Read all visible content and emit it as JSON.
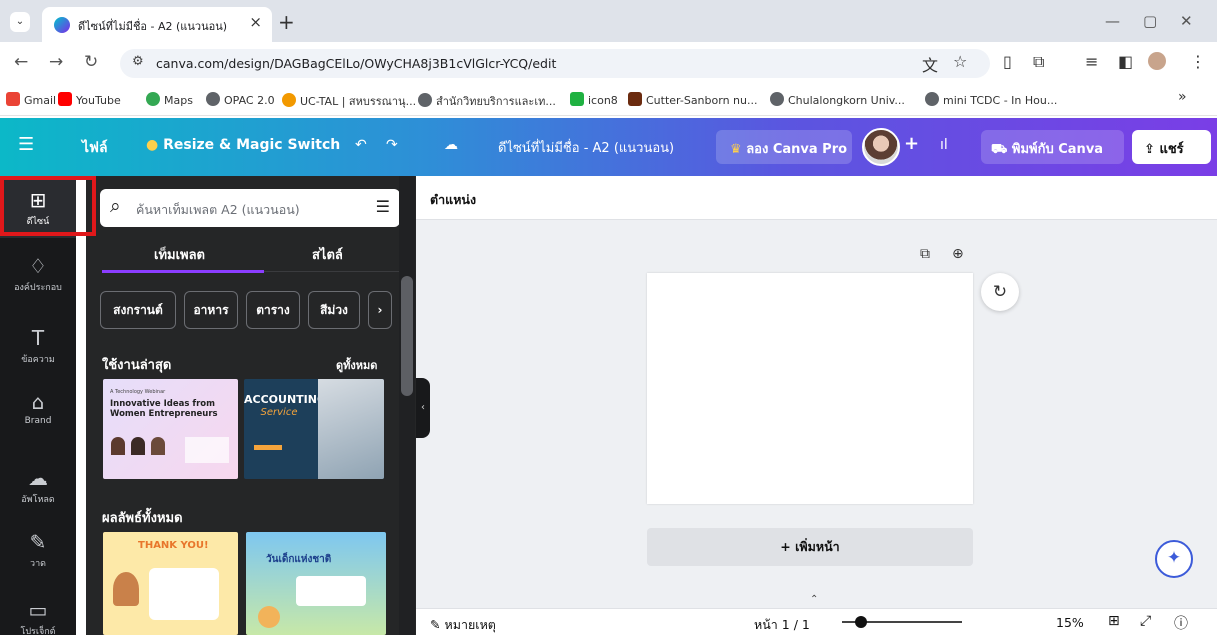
{
  "browser": {
    "tab_title": "ดีไซน์ที่ไม่มีชื่อ - A2 (แนวนอน)",
    "tab_close": "×",
    "new_tab": "+",
    "url": "canva.com/design/DAGBagCElLo/OWyCHA8j3B1cVlGlcr-YCQ/edit",
    "bookmarks": [
      {
        "label": "Gmail",
        "color": "#ea4335"
      },
      {
        "label": "YouTube",
        "color": "#ff0000"
      },
      {
        "label": "Maps",
        "color": "#34a853"
      },
      {
        "label": "OPAC 2.0",
        "color": "#5f6368"
      },
      {
        "label": "UC-TAL | สหบรรณานุ...",
        "color": "#f29900"
      },
      {
        "label": "สำนักวิทยบริการและเท...",
        "color": "#5f6368"
      },
      {
        "label": "icon8",
        "color": "#1fb141"
      },
      {
        "label": "Cutter-Sanborn nu...",
        "color": "#6b2b0f"
      },
      {
        "label": "Chulalongkorn Univ...",
        "color": "#5f6368"
      },
      {
        "label": "mini TCDC - In Hou...",
        "color": "#5f6368"
      }
    ],
    "more": "»"
  },
  "header": {
    "menu_icon": "☰",
    "file": "ไฟล์",
    "resize": "Resize & Magic Switch",
    "doc_title": "ดีไซน์ที่ไม่มีชื่อ - A2 (แนวนอน)",
    "try_pro": "ลอง Canva Pro",
    "print": "พิมพ์กับ Canva",
    "share": "แชร์"
  },
  "rail": [
    {
      "icon": "⊞",
      "label": "ดีไซน์"
    },
    {
      "icon": "♢",
      "label": "องค์ประกอบ"
    },
    {
      "icon": "T",
      "label": "ข้อความ"
    },
    {
      "icon": "⌂",
      "label": "Brand"
    },
    {
      "icon": "☁",
      "label": "อัพโหลด"
    },
    {
      "icon": "✎",
      "label": "วาด"
    },
    {
      "icon": "▭",
      "label": "โปรเจ็กต์"
    }
  ],
  "panel": {
    "search_placeholder": "ค้นหาเท็มเพลต A2 (แนวนอน)",
    "tab_templates": "เท็มเพลต",
    "tab_styles": "สไตล์",
    "chips": [
      "สงกรานต์",
      "อาหาร",
      "ตาราง",
      "สีม่วง"
    ],
    "recent": "ใช้งานล่าสุด",
    "see_all": "ดูทั้งหมด",
    "all_results": "ผลลัพธ์ทั้งหมด",
    "thumb1_title": "Innovative Ideas from Women Entrepreneurs",
    "thumb1_sub": "A Technology Webinar",
    "thumb2_title": "ACCOUNTING",
    "thumb2_sub": "Service",
    "thumb3_title": "THANK YOU!",
    "thumb4_title": "วันเด็กแห่งชาติ"
  },
  "editor": {
    "position": "ตำแหน่ง",
    "add_page": "+ เพิ่มหน้า",
    "notes": "หมายเหตุ",
    "page_indicator": "หน้า 1 / 1",
    "zoom": "15%",
    "zoom_fraction": 0.15
  }
}
